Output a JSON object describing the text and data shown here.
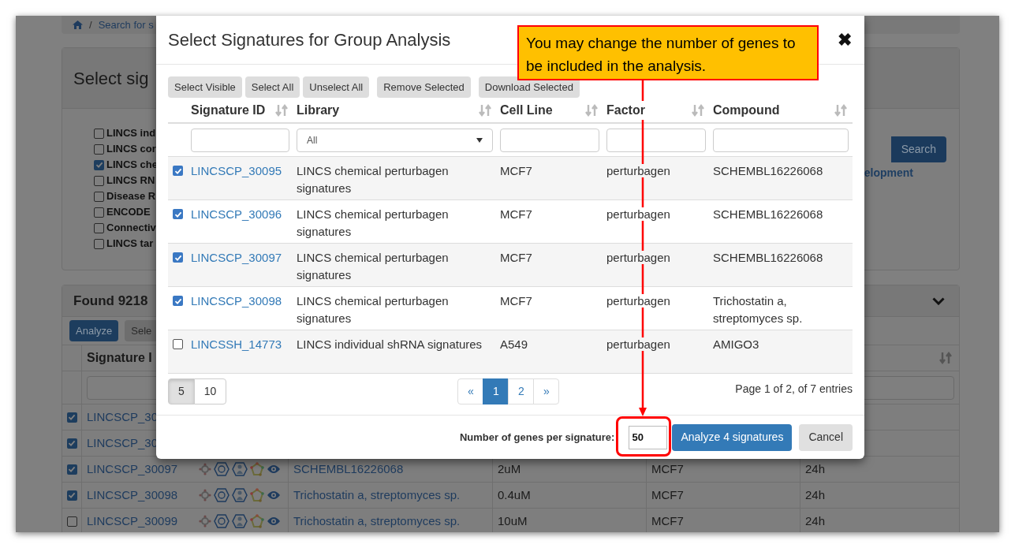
{
  "background": {
    "breadcrumb": {
      "separator": "/",
      "text": "Search for s"
    },
    "libraries_panel": {
      "title": "Select sig",
      "libraries": [
        {
          "label": "LINCS ind",
          "checked": false
        },
        {
          "label": "LINCS cor",
          "checked": false
        },
        {
          "label": "LINCS che",
          "checked": true
        },
        {
          "label": "LINCS RN",
          "checked": false
        },
        {
          "label": "Disease R",
          "checked": false
        },
        {
          "label": "ENCODE",
          "checked": false
        },
        {
          "label": "Connectiv",
          "checked": false
        },
        {
          "label": "LINCS tar",
          "checked": false
        }
      ],
      "search_button": "Search",
      "link": "elopment"
    },
    "results_panel": {
      "title": "Found 9218",
      "buttons": [
        "Analyze",
        "Sele"
      ],
      "column_1": "Signature I",
      "rows": [
        {
          "checked": true,
          "id": "LINCSCP_30"
        },
        {
          "checked": true,
          "id": "LINCSCP_30"
        },
        {
          "checked": true,
          "id": "LINCSCP_30097",
          "compound": "SCHEMBL16226068",
          "dose": "2uM",
          "cell_line": "MCF7",
          "time": "24h"
        },
        {
          "checked": true,
          "id": "LINCSCP_30098",
          "compound": "Trichostatin a, streptomyces sp.",
          "dose": "0.4uM",
          "cell_line": "MCF7",
          "time": "24h"
        },
        {
          "checked": false,
          "id": "LINCSCP_30099",
          "compound": "Trichostatin a, streptomyces sp.",
          "dose": "10uM",
          "cell_line": "MCF7",
          "time": "24h"
        }
      ]
    }
  },
  "dialog": {
    "title": "Select Signatures for Group Analysis",
    "toolbar": [
      "Select Visible",
      "Select All",
      "Unselect All",
      "Remove Selected",
      "Download Selected"
    ],
    "columns": [
      {
        "label": "Signature ID",
        "filter": {
          "kind": "text"
        }
      },
      {
        "label": "Library",
        "filter": {
          "kind": "select",
          "value": "All"
        }
      },
      {
        "label": "Cell Line",
        "filter": {
          "kind": "text"
        }
      },
      {
        "label": "Factor",
        "filter": {
          "kind": "text"
        }
      },
      {
        "label": "Compound",
        "filter": {
          "kind": "text"
        }
      }
    ],
    "rows": [
      {
        "selected": true,
        "id": "LINCSCP_30095",
        "library": "LINCS chemical perturbagen signatures",
        "cell_line": "MCF7",
        "factor": "perturbagen",
        "compound": "SCHEMBL16226068"
      },
      {
        "selected": true,
        "id": "LINCSCP_30096",
        "library": "LINCS chemical perturbagen signatures",
        "cell_line": "MCF7",
        "factor": "perturbagen",
        "compound": "SCHEMBL16226068"
      },
      {
        "selected": true,
        "id": "LINCSCP_30097",
        "library": "LINCS chemical perturbagen signatures",
        "cell_line": "MCF7",
        "factor": "perturbagen",
        "compound": "SCHEMBL16226068"
      },
      {
        "selected": true,
        "id": "LINCSCP_30098",
        "library": "LINCS chemical perturbagen signatures",
        "cell_line": "MCF7",
        "factor": "perturbagen",
        "compound": "Trichostatin a, streptomyces sp."
      },
      {
        "selected": false,
        "id": "LINCSSH_14773",
        "library": "LINCS individual shRNA signatures",
        "cell_line": "A549",
        "factor": "perturbagen",
        "compound": "AMIGO3"
      }
    ],
    "page_sizes": [
      {
        "label": "5",
        "selected": true
      },
      {
        "label": "10",
        "selected": false
      }
    ],
    "pager": [
      {
        "label": "«",
        "selected": false
      },
      {
        "label": "1",
        "selected": true
      },
      {
        "label": "2",
        "selected": false
      },
      {
        "label": "»",
        "selected": false
      }
    ],
    "page_info": "Page 1 of 2, of 7 entries",
    "genes_label": "Number of genes per signature:",
    "genes_value": "50",
    "analyze_button": "Analyze 4 signatures",
    "cancel_button": "Cancel",
    "close": "✖"
  },
  "callout": {
    "text": "You may change the number of genes to be included in the analysis."
  }
}
